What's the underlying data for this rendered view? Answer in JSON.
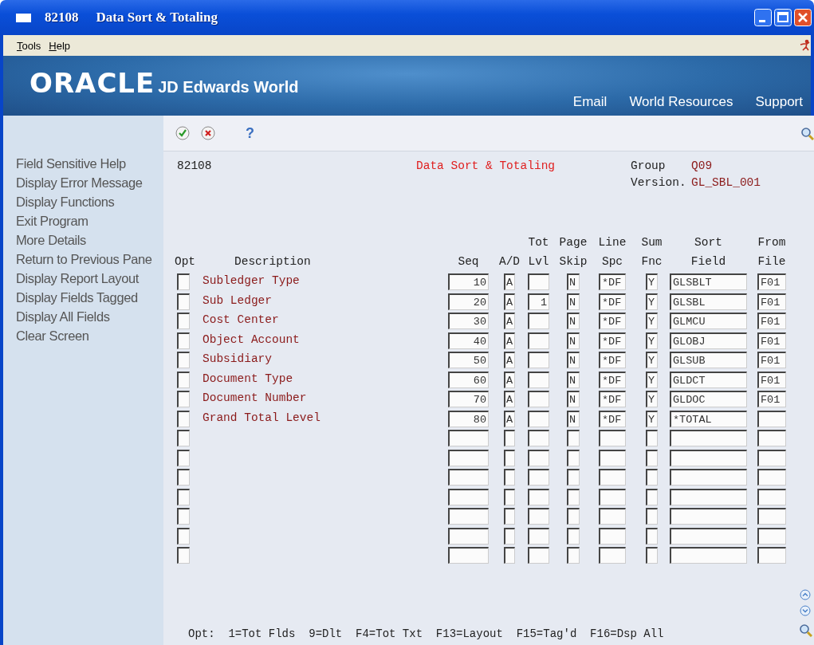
{
  "window": {
    "program": "82108",
    "title": "Data Sort & Totaling"
  },
  "menu": [
    {
      "label": "Tools"
    },
    {
      "label": "Help"
    }
  ],
  "banner": {
    "logo": "ORACLE",
    "product": "JD Edwards World",
    "links": [
      "Email",
      "World Resources",
      "Support"
    ]
  },
  "toolbar": {
    "help": "?"
  },
  "sidebar": {
    "items": [
      "Field Sensitive Help",
      "Display Error Message",
      "Display Functions",
      "Exit Program",
      "More Details",
      "Return to Previous Pane",
      "Display Report Layout",
      "Display Fields Tagged",
      "Display All Fields",
      "Clear Screen"
    ]
  },
  "form": {
    "program": "82108",
    "title": "Data Sort & Totaling",
    "group_label": "Group",
    "group": "Q09",
    "version_label": "Version.",
    "version": "GL_SBL_001",
    "columns": [
      {
        "lines": [
          "Opt"
        ]
      },
      {
        "lines": [
          "Description"
        ]
      },
      {
        "lines": [
          "Seq"
        ]
      },
      {
        "lines": [
          "A/D"
        ]
      },
      {
        "lines": [
          "Tot",
          "Lvl"
        ]
      },
      {
        "lines": [
          "Page",
          "Skip"
        ]
      },
      {
        "lines": [
          "Line",
          "Spc"
        ]
      },
      {
        "lines": [
          "Sum",
          "Fnc"
        ]
      },
      {
        "lines": [
          "Sort",
          "Field"
        ]
      },
      {
        "lines": [
          "From",
          "File"
        ]
      }
    ],
    "rows": [
      {
        "kind": "entry",
        "description": "Subledger Type",
        "seq": "10",
        "ad": "A",
        "page": "N",
        "line": "*DF",
        "sum": "Y",
        "sort": "GLSBLT",
        "file": "F01"
      },
      {
        "kind": "entry",
        "description": "Sub Ledger",
        "seq": "20",
        "ad": "A",
        "tot": "1",
        "page": "N",
        "line": "*DF",
        "sum": "Y",
        "sort": "GLSBL",
        "file": "F01"
      },
      {
        "kind": "entry",
        "description": "Cost Center",
        "seq": "30",
        "ad": "A",
        "page": "N",
        "line": "*DF",
        "sum": "Y",
        "sort": "GLMCU",
        "file": "F01"
      },
      {
        "kind": "entry",
        "description": "Object Account",
        "seq": "40",
        "ad": "A",
        "page": "N",
        "line": "*DF",
        "sum": "Y",
        "sort": "GLOBJ",
        "file": "F01"
      },
      {
        "kind": "entry",
        "description": "Subsidiary",
        "seq": "50",
        "ad": "A",
        "page": "N",
        "line": "*DF",
        "sum": "Y",
        "sort": "GLSUB",
        "file": "F01"
      },
      {
        "kind": "entry",
        "description": "Document Type",
        "seq": "60",
        "ad": "A",
        "page": "N",
        "line": "*DF",
        "sum": "Y",
        "sort": "GLDCT",
        "file": "F01"
      },
      {
        "kind": "entry",
        "description": "Document Number",
        "seq": "70",
        "ad": "A",
        "page": "N",
        "line": "*DF",
        "sum": "Y",
        "sort": "GLDOC",
        "file": "F01"
      },
      {
        "kind": "entry",
        "description": "Grand Total Level",
        "seq": "80",
        "ad": "A",
        "page": "N",
        "line": "*DF",
        "sum": "Y",
        "sort": "*TOTAL"
      },
      {
        "kind": "blank"
      },
      {
        "kind": "blank"
      },
      {
        "kind": "blank"
      },
      {
        "kind": "blank"
      },
      {
        "kind": "blank"
      },
      {
        "kind": "blank"
      },
      {
        "kind": "blank"
      }
    ],
    "function_keys": "Opt:  1=Tot Flds  9=Dlt  F4=Tot Txt  F13=Layout  F15=Tag'd  F16=Dsp All"
  }
}
